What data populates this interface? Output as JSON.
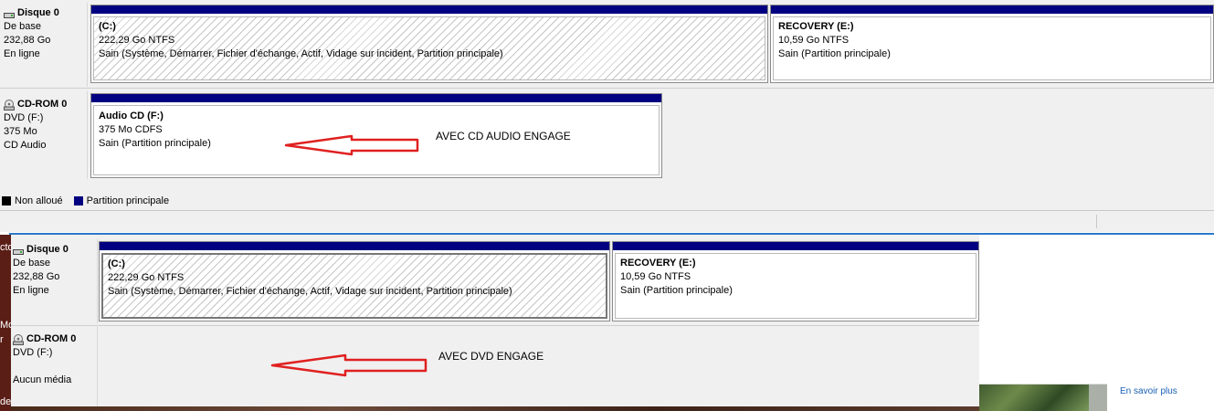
{
  "top": {
    "disk0": {
      "name": "Disque 0",
      "type": "De base",
      "size": "232,88 Go",
      "status": "En ligne"
    },
    "cdrom": {
      "name": "CD-ROM 0",
      "type": "DVD (F:)",
      "size": "375 Mo",
      "media": "CD Audio"
    },
    "c_part": {
      "title": "(C:)",
      "size_fs": "222,29 Go NTFS",
      "status": "Sain (Système, Démarrer, Fichier d'échange, Actif, Vidage sur incident, Partition principale)"
    },
    "recovery": {
      "title": "RECOVERY  (E:)",
      "size_fs": "10,59 Go NTFS",
      "status": "Sain (Partition principale)"
    },
    "audio_cd": {
      "title": "Audio CD  (F:)",
      "size_fs": "375 Mo CDFS",
      "status": "Sain (Partition principale)"
    },
    "annotation": "AVEC CD AUDIO ENGAGE"
  },
  "legend": {
    "unallocated": "Non alloué",
    "primary": "Partition principale"
  },
  "bottom": {
    "disk0": {
      "name": "Disque 0",
      "type": "De base",
      "size": "232,88 Go",
      "status": "En ligne"
    },
    "cdrom": {
      "name": "CD-ROM 0",
      "type": "DVD (F:)",
      "media": "Aucun média"
    },
    "c_part": {
      "title": "(C:)",
      "size_fs": "222,29 Go NTFS",
      "status": "Sain (Système, Démarrer, Fichier d'échange, Actif, Vidage sur incident, Partition principale)"
    },
    "recovery": {
      "title": "RECOVERY  (E:)",
      "size_fs": "10,59 Go NTFS",
      "status": "Sain (Partition principale)"
    },
    "annotation": "AVEC DVD ENGAGE"
  },
  "background": {
    "left_fragments": [
      "cto",
      "Mo",
      "r",
      "de"
    ],
    "link": "En savoir plus"
  },
  "colors": {
    "primary_partition": "#000080",
    "unallocated": "#000000",
    "arrow": "#e02020",
    "link": "#1a5fb4",
    "desktop": "#5a1e16"
  }
}
